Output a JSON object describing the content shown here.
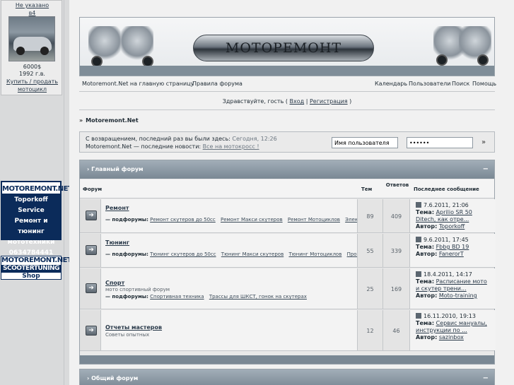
{
  "sidebar": {
    "top_link": "Не указано",
    "model": "в4",
    "price": "6000$",
    "year": "1992 г.в.",
    "buy_sell": "Купить / продать",
    "moto": "мотоцикл",
    "ad1": {
      "header": "MOTOREMONT.NET",
      "lines": [
        "Toporkoff Service",
        "Ремонт и тюнинг",
        "мототехники",
        "0634784441"
      ]
    },
    "ad2": {
      "header": "MOTOREMONT.NET",
      "sub1": "SCOOTERTUNING",
      "sub2": "Shop"
    }
  },
  "banner": {
    "logo_text": "МОТОРЕМОНТ"
  },
  "nav": {
    "home": "Motoremont.Net на главную страницу",
    "rules": "Правила форума",
    "calendar": "Календарь",
    "users": "Пользователи",
    "search": "Поиск",
    "help": "Помощь"
  },
  "greeting": {
    "text": "Здравствуйте, гость (",
    "login": "Вход",
    "sep": "|",
    "register": "Регистрация",
    "close": ")"
  },
  "breadcrumb": "Motoremont.Net",
  "login_box": {
    "welcome": "С возвращением, последний раз вы были здесь:",
    "last_visit": "Сегодня, 12:26",
    "news_label": "Motoremont.Net — последние новости:",
    "news_link": "Все на мотокросс !",
    "username_placeholder": "Имя пользователя",
    "password_value": "••••••"
  },
  "section1": {
    "title": "Главный форум",
    "toggle": "−",
    "col_forum": "Форум",
    "col_topics": "Тем",
    "col_answers": "Ответов",
    "col_last": "Последнее сообщение",
    "forums": [
      {
        "name": "Ремонт",
        "desc": "",
        "subs_label": "— подфорумы:",
        "subs": [
          "Ремонт скутеров до 50сс",
          "Ремонт Макси скутеров",
          "Ремонт Мотоциклов",
          "Электрика"
        ],
        "topics": "89",
        "answers": "409",
        "last_date": "7.6.2011, 21:06",
        "last_topic_label": "Тема:",
        "last_topic": "Aprilio SR 50 Ditech, как отре...",
        "last_author_label": "Автор:",
        "last_author": "Toporkoff"
      },
      {
        "name": "Тюнинг",
        "desc": "",
        "subs_label": "— подфорумы:",
        "subs": [
          "Тюнинг скутеров до 50сс",
          "Тюнинг Макси скутеров",
          "Тюнинг Мотоциклов",
          "Проекты"
        ],
        "topics": "55",
        "answers": "339",
        "last_date": "9.6.2011, 17:45",
        "last_topic_label": "Тема:",
        "last_topic": "Fbbg BD 19",
        "last_author_label": "Автор:",
        "last_author": "FanerorT"
      },
      {
        "name": "Спорт",
        "desc": "мото спортивный форум",
        "subs_label": "— подфорумы:",
        "subs": [
          "Спортивная техника",
          "Трассы для ШКСТ, гонок на скутерах"
        ],
        "topics": "25",
        "answers": "169",
        "last_date": "18.4.2011, 14:17",
        "last_topic_label": "Тема:",
        "last_topic": "Расписание мото и скутер трени...",
        "last_author_label": "Автор:",
        "last_author": "Moto-training"
      },
      {
        "name": "Отчеты мастеров",
        "desc": "Советы опытных",
        "subs_label": "",
        "subs": [],
        "topics": "12",
        "answers": "46",
        "last_date": "16.11.2010, 19:13",
        "last_topic_label": "Тема:",
        "last_topic": "Сервис мануалы, инструкции по ...",
        "last_author_label": "Автор:",
        "last_author": "sazinbox"
      }
    ]
  },
  "section2": {
    "title": "Общий форум",
    "toggle": "−"
  },
  "colors": {
    "header_bar": "#7a8894",
    "page_bg": "#d9dadb",
    "ad_blue": "#0b2b5a"
  }
}
